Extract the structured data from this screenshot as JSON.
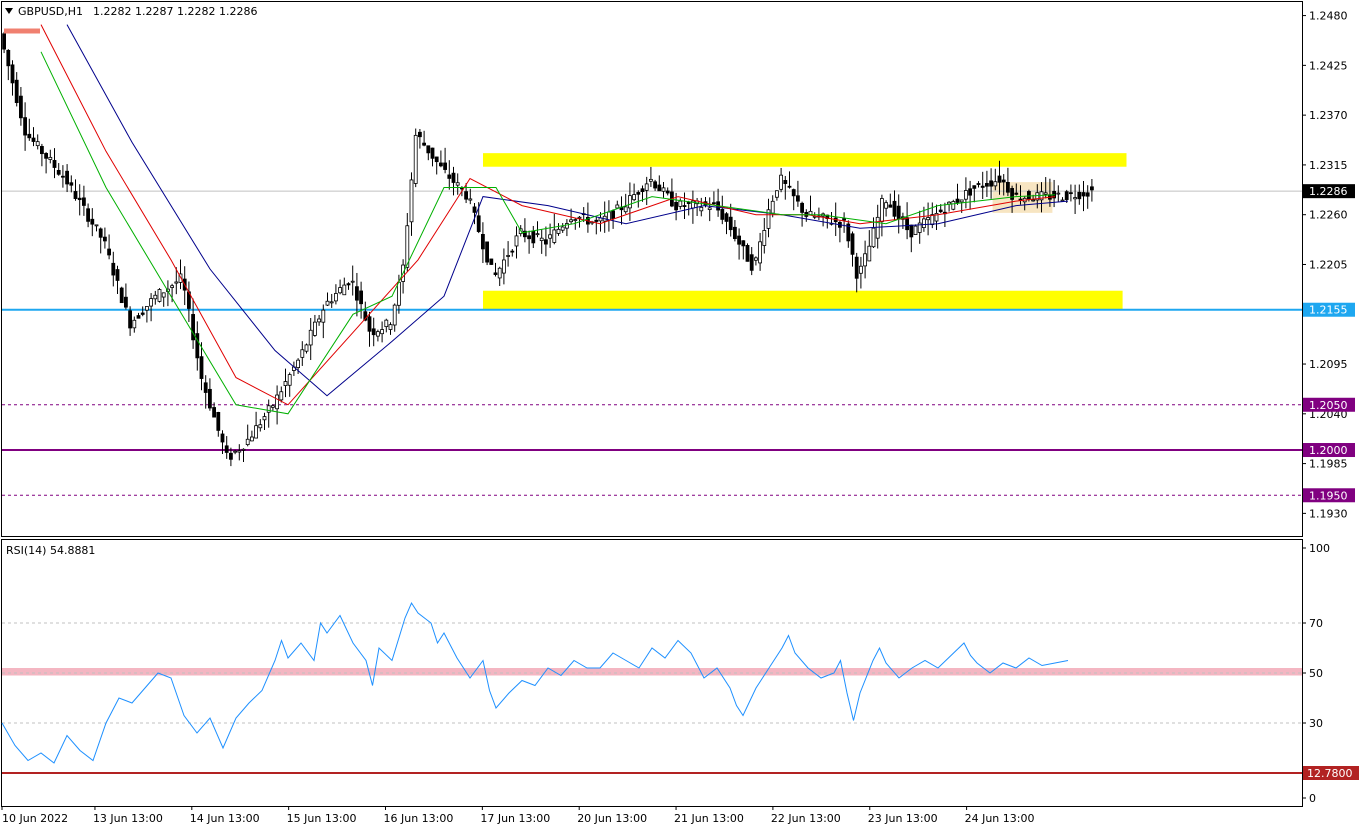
{
  "header": {
    "symbol_label": "GBPUSD,H1",
    "ohlc": "1.2282 1.2287 1.2282 1.2286"
  },
  "rsi_header": "RSI(14) 54.8881",
  "colors": {
    "bull_candle": "#ffffff",
    "bear_candle": "#000000",
    "ma_fast": "#00b000",
    "ma_mid": "#e00000",
    "ma_slow": "#00008b",
    "rsi_line": "#1e90ff",
    "zone": "#ffff00",
    "support_line": "#1ea7f0",
    "level_1200": "#800080",
    "rsi_floor_line": "#b22222",
    "rsi_mid_band": "#f4b6c2",
    "current_price_box": "#000000",
    "recent_box": "#f5deb3"
  },
  "chart_data": [
    {
      "type": "candlestick",
      "symbol": "GBPUSD",
      "timeframe": "H1",
      "ylim": [
        1.1905,
        1.2495
      ],
      "y_ticks": [
        "1.2480",
        "1.2425",
        "1.2370",
        "1.2315",
        "1.2286",
        "1.2260",
        "1.2205",
        "1.2155",
        "1.2095",
        "1.2050",
        "1.2040",
        "1.2000",
        "1.1985",
        "1.1950",
        "1.1930"
      ],
      "x_ticks": [
        "10 Jun 2022",
        "13 Jun 13:00",
        "14 Jun 13:00",
        "15 Jun 13:00",
        "16 Jun 13:00",
        "17 Jun 13:00",
        "20 Jun 13:00",
        "21 Jun 13:00",
        "22 Jun 13:00",
        "23 Jun 13:00",
        "24 Jun 13:00"
      ],
      "current_price": "1.2286",
      "price_path": [
        [
          0,
          1.246
        ],
        [
          0.02,
          1.235
        ],
        [
          0.05,
          1.23
        ],
        [
          0.08,
          1.223
        ],
        [
          0.1,
          1.214
        ],
        [
          0.12,
          1.217
        ],
        [
          0.14,
          1.219
        ],
        [
          0.155,
          1.208
        ],
        [
          0.175,
          1.199
        ],
        [
          0.19,
          1.201
        ],
        [
          0.21,
          1.205
        ],
        [
          0.23,
          1.21
        ],
        [
          0.25,
          1.216
        ],
        [
          0.27,
          1.219
        ],
        [
          0.285,
          1.213
        ],
        [
          0.3,
          1.214
        ],
        [
          0.31,
          1.22
        ],
        [
          0.32,
          1.235
        ],
        [
          0.34,
          1.231
        ],
        [
          0.36,
          1.228
        ],
        [
          0.38,
          1.219
        ],
        [
          0.4,
          1.224
        ],
        [
          0.42,
          1.223
        ],
        [
          0.44,
          1.226
        ],
        [
          0.46,
          1.225
        ],
        [
          0.48,
          1.227
        ],
        [
          0.5,
          1.23
        ],
        [
          0.52,
          1.227
        ],
        [
          0.55,
          1.227
        ],
        [
          0.56,
          1.225
        ],
        [
          0.58,
          1.22
        ],
        [
          0.59,
          1.226
        ],
        [
          0.6,
          1.23
        ],
        [
          0.62,
          1.226
        ],
        [
          0.65,
          1.225
        ],
        [
          0.66,
          1.219
        ],
        [
          0.67,
          1.223
        ],
        [
          0.68,
          1.228
        ],
        [
          0.7,
          1.224
        ],
        [
          0.72,
          1.226
        ],
        [
          0.75,
          1.229
        ],
        [
          0.77,
          1.23
        ],
        [
          0.78,
          1.228
        ],
        [
          0.8,
          1.228
        ],
        [
          0.82,
          1.2281
        ],
        [
          0.84,
          1.2286
        ]
      ],
      "ma_fast_path": [
        [
          0.03,
          1.244
        ],
        [
          0.08,
          1.229
        ],
        [
          0.13,
          1.217
        ],
        [
          0.18,
          1.205
        ],
        [
          0.22,
          1.204
        ],
        [
          0.27,
          1.215
        ],
        [
          0.3,
          1.217
        ],
        [
          0.34,
          1.229
        ],
        [
          0.38,
          1.229
        ],
        [
          0.4,
          1.224
        ],
        [
          0.44,
          1.225
        ],
        [
          0.5,
          1.228
        ],
        [
          0.55,
          1.227
        ],
        [
          0.6,
          1.226
        ],
        [
          0.63,
          1.226
        ],
        [
          0.68,
          1.225
        ],
        [
          0.72,
          1.227
        ],
        [
          0.78,
          1.228
        ],
        [
          0.81,
          1.2282
        ]
      ],
      "ma_mid_path": [
        [
          0.03,
          1.247
        ],
        [
          0.08,
          1.233
        ],
        [
          0.13,
          1.221
        ],
        [
          0.18,
          1.208
        ],
        [
          0.22,
          1.205
        ],
        [
          0.27,
          1.213
        ],
        [
          0.32,
          1.221
        ],
        [
          0.36,
          1.23
        ],
        [
          0.4,
          1.227
        ],
        [
          0.46,
          1.225
        ],
        [
          0.52,
          1.228
        ],
        [
          0.58,
          1.226
        ],
        [
          0.62,
          1.226
        ],
        [
          0.66,
          1.225
        ],
        [
          0.72,
          1.226
        ],
        [
          0.78,
          1.2275
        ],
        [
          0.81,
          1.228
        ]
      ],
      "ma_slow_path": [
        [
          0.05,
          1.247
        ],
        [
          0.1,
          1.234
        ],
        [
          0.16,
          1.22
        ],
        [
          0.21,
          1.211
        ],
        [
          0.25,
          1.206
        ],
        [
          0.3,
          1.212
        ],
        [
          0.34,
          1.217
        ],
        [
          0.37,
          1.228
        ],
        [
          0.42,
          1.227
        ],
        [
          0.48,
          1.225
        ],
        [
          0.54,
          1.227
        ],
        [
          0.6,
          1.226
        ],
        [
          0.66,
          1.2245
        ],
        [
          0.72,
          1.225
        ],
        [
          0.78,
          1.227
        ],
        [
          0.82,
          1.2275
        ]
      ],
      "zones": [
        {
          "name": "resistance-zone",
          "x_start": 0.37,
          "x_end": 0.865,
          "y_top": 1.2328,
          "y_bottom": 1.2313
        },
        {
          "name": "support-zone",
          "x_start": 0.37,
          "x_end": 0.862,
          "y_top": 1.2176,
          "y_bottom": 1.2155
        }
      ],
      "recent_box": {
        "x_start": 0.762,
        "x_end": 0.808,
        "y_top": 1.2296,
        "y_bottom": 1.2262
      },
      "horizontal_lines": [
        {
          "value": 1.2286,
          "style": "solid",
          "label": "1.2286",
          "color": "#c0c0c0"
        },
        {
          "value": 1.2155,
          "style": "solid",
          "label": "1.2155",
          "color": "#1ea7f0"
        },
        {
          "value": 1.205,
          "style": "dashed",
          "label": "1.2050",
          "color": "#800080"
        },
        {
          "value": 1.2,
          "style": "solid",
          "label": "1.2000",
          "color": "#800080"
        },
        {
          "value": 1.195,
          "style": "dashed",
          "label": "1.1950",
          "color": "#800080"
        }
      ]
    },
    {
      "type": "line",
      "name": "RSI(14)",
      "value": "54.8881",
      "ylim": [
        0,
        100
      ],
      "y_ticks": [
        "100",
        "70",
        "50",
        "30",
        "0"
      ],
      "levels": [
        70,
        50,
        30
      ],
      "floor_line": {
        "value": 10,
        "label": "12.7800"
      },
      "values": [
        [
          0,
          30
        ],
        [
          0.01,
          21
        ],
        [
          0.02,
          15
        ],
        [
          0.03,
          18
        ],
        [
          0.04,
          14
        ],
        [
          0.05,
          25
        ],
        [
          0.06,
          19
        ],
        [
          0.07,
          15
        ],
        [
          0.08,
          30
        ],
        [
          0.09,
          40
        ],
        [
          0.1,
          38
        ],
        [
          0.11,
          44
        ],
        [
          0.12,
          50
        ],
        [
          0.13,
          48
        ],
        [
          0.14,
          33
        ],
        [
          0.15,
          26
        ],
        [
          0.16,
          32
        ],
        [
          0.17,
          20
        ],
        [
          0.18,
          32
        ],
        [
          0.19,
          38
        ],
        [
          0.2,
          43
        ],
        [
          0.21,
          55
        ],
        [
          0.215,
          63
        ],
        [
          0.22,
          56
        ],
        [
          0.23,
          62
        ],
        [
          0.24,
          55
        ],
        [
          0.245,
          70
        ],
        [
          0.25,
          66
        ],
        [
          0.26,
          73
        ],
        [
          0.27,
          62
        ],
        [
          0.28,
          55
        ],
        [
          0.285,
          45
        ],
        [
          0.29,
          60
        ],
        [
          0.3,
          55
        ],
        [
          0.31,
          72
        ],
        [
          0.315,
          78
        ],
        [
          0.32,
          74
        ],
        [
          0.33,
          70
        ],
        [
          0.335,
          62
        ],
        [
          0.34,
          66
        ],
        [
          0.35,
          56
        ],
        [
          0.36,
          48
        ],
        [
          0.37,
          55
        ],
        [
          0.375,
          43
        ],
        [
          0.38,
          36
        ],
        [
          0.39,
          42
        ],
        [
          0.4,
          47
        ],
        [
          0.41,
          45
        ],
        [
          0.42,
          52
        ],
        [
          0.43,
          49
        ],
        [
          0.44,
          55
        ],
        [
          0.45,
          52
        ],
        [
          0.46,
          52
        ],
        [
          0.47,
          58
        ],
        [
          0.48,
          55
        ],
        [
          0.49,
          52
        ],
        [
          0.5,
          60
        ],
        [
          0.51,
          56
        ],
        [
          0.52,
          63
        ],
        [
          0.53,
          58
        ],
        [
          0.54,
          48
        ],
        [
          0.55,
          52
        ],
        [
          0.56,
          44
        ],
        [
          0.565,
          37
        ],
        [
          0.57,
          33
        ],
        [
          0.58,
          44
        ],
        [
          0.59,
          52
        ],
        [
          0.6,
          60
        ],
        [
          0.605,
          65
        ],
        [
          0.61,
          58
        ],
        [
          0.62,
          52
        ],
        [
          0.63,
          48
        ],
        [
          0.64,
          50
        ],
        [
          0.645,
          55
        ],
        [
          0.65,
          42
        ],
        [
          0.655,
          31
        ],
        [
          0.66,
          42
        ],
        [
          0.67,
          55
        ],
        [
          0.675,
          60
        ],
        [
          0.68,
          54
        ],
        [
          0.69,
          48
        ],
        [
          0.7,
          52
        ],
        [
          0.71,
          55
        ],
        [
          0.72,
          52
        ],
        [
          0.73,
          57
        ],
        [
          0.74,
          62
        ],
        [
          0.745,
          57
        ],
        [
          0.75,
          54
        ],
        [
          0.76,
          50
        ],
        [
          0.77,
          54
        ],
        [
          0.78,
          52
        ],
        [
          0.79,
          56
        ],
        [
          0.8,
          53
        ],
        [
          0.81,
          54
        ],
        [
          0.82,
          55
        ]
      ],
      "mid_band": {
        "low": 49,
        "high": 52
      }
    }
  ]
}
